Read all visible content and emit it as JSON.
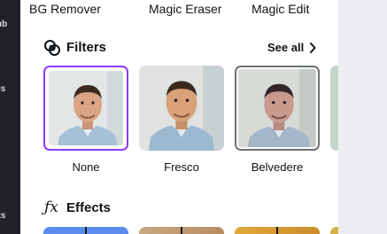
{
  "left_rail": {
    "labels": [
      "ub",
      "ls",
      "cts"
    ]
  },
  "top_tools": [
    "BG Remover",
    "Magic Eraser",
    "Magic Edit"
  ],
  "filters": {
    "title": "Filters",
    "see_all": "See all",
    "items": [
      {
        "label": "None",
        "selected": true
      },
      {
        "label": "Fresco",
        "selected": false
      },
      {
        "label": "Belvedere",
        "selected": false
      }
    ]
  },
  "effects": {
    "title": "Effects"
  },
  "colors": {
    "accent": "#8b3dff",
    "text": "#0e1318",
    "rail": "#1f2126"
  }
}
